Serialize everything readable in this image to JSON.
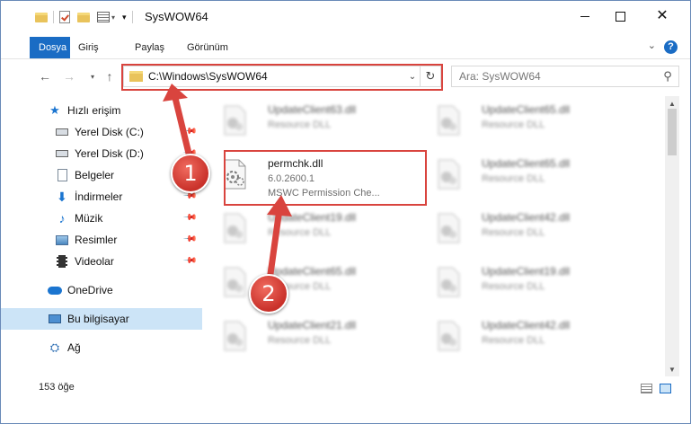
{
  "window": {
    "title": "SysWOW64",
    "minimize_icon": "minimize-icon",
    "maximize_icon": "maximize-icon",
    "close_icon": "close-icon"
  },
  "ribbon": {
    "tabs": [
      {
        "label": "Dosya"
      },
      {
        "label": "Giriş"
      },
      {
        "label": "Paylaş"
      },
      {
        "label": "Görünüm"
      }
    ],
    "help": "?"
  },
  "address": {
    "path": "C:\\Windows\\SysWOW64"
  },
  "search": {
    "placeholder": "Ara: SysWOW64"
  },
  "sidebar": {
    "items": [
      {
        "label": "Hızlı erişim",
        "icon": "star-icon"
      },
      {
        "label": "Yerel Disk (C:)",
        "icon": "drive-icon"
      },
      {
        "label": "Yerel Disk (D:)",
        "icon": "drive-icon"
      },
      {
        "label": "Belgeler",
        "icon": "document-icon"
      },
      {
        "label": "İndirmeler",
        "icon": "download-icon"
      },
      {
        "label": "Müzik",
        "icon": "music-icon"
      },
      {
        "label": "Resimler",
        "icon": "pictures-icon"
      },
      {
        "label": "Videolar",
        "icon": "videos-icon"
      },
      {
        "label": "OneDrive",
        "icon": "onedrive-icon"
      },
      {
        "label": "Bu bilgisayar",
        "icon": "computer-icon"
      },
      {
        "label": "Ağ",
        "icon": "network-icon"
      }
    ]
  },
  "files": {
    "left": [
      {
        "name": "UpdateClient63.dll",
        "desc": "Resource DLL"
      },
      {
        "name": "permchk.dll",
        "version": "6.0.2600.1",
        "desc": "MSWC Permission Che..."
      },
      {
        "name": "UpdateClient19.dll",
        "desc": "Resource DLL"
      },
      {
        "name": "UpdateClient65.dll",
        "desc": "Resource DLL"
      },
      {
        "name": "UpdateClient21.dll",
        "desc": "Resource DLL"
      }
    ],
    "right": [
      {
        "name": "UpdateClient65.dll",
        "desc": "Resource DLL"
      },
      {
        "name": "UpdateClient65.dll",
        "desc": "Resource DLL"
      },
      {
        "name": "UpdateClient42.dll",
        "desc": "Resource DLL"
      },
      {
        "name": "UpdateClient19.dll",
        "desc": "Resource DLL"
      },
      {
        "name": "UpdateClient42.dll",
        "desc": "Resource DLL"
      }
    ]
  },
  "status": {
    "count": "153 öğe"
  },
  "callouts": [
    "1",
    "2"
  ],
  "colors": {
    "accent": "#1a6cc4",
    "highlight": "#d9443e",
    "selected": "#cce4f7"
  }
}
